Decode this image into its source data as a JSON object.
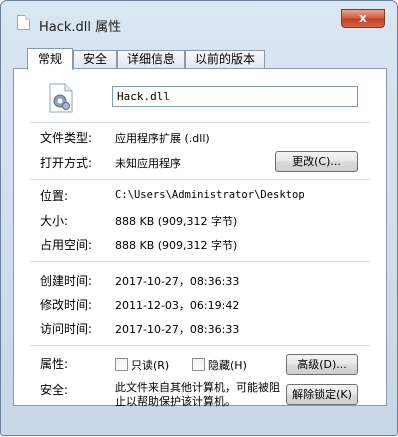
{
  "window": {
    "title": "Hack.dll 属性",
    "close_label": "x"
  },
  "tabs": [
    {
      "label": "常规"
    },
    {
      "label": "安全"
    },
    {
      "label": "详细信息"
    },
    {
      "label": "以前的版本"
    }
  ],
  "general": {
    "file_name": "Hack.dll",
    "file_type": {
      "label": "文件类型:",
      "value": "应用程序扩展 (.dll)"
    },
    "open_with": {
      "label": "打开方式:",
      "value": "未知应用程序",
      "button": "更改(C)..."
    },
    "location": {
      "label": "位置:",
      "value": "C:\\Users\\Administrator\\Desktop"
    },
    "size": {
      "label": "大小:",
      "value": "888 KB (909,312 字节)"
    },
    "size_on_disk": {
      "label": "占用空间:",
      "value": "888 KB (909,312 字节)"
    },
    "created": {
      "label": "创建时间:",
      "value": "2017-10-27，08:36:33"
    },
    "modified": {
      "label": "修改时间:",
      "value": "2011-12-03，06:19:42"
    },
    "accessed": {
      "label": "访问时间:",
      "value": "2017-10-27，08:36:33"
    },
    "attributes": {
      "label": "属性:",
      "readonly_label": "只读(R)",
      "hidden_label": "隐藏(H)",
      "advanced_button": "高级(D)..."
    },
    "security": {
      "label": "安全:",
      "text": "此文件来自其他计算机，可能被阻止以帮助保护该计算机。",
      "unblock_button": "解除锁定(K)"
    }
  }
}
